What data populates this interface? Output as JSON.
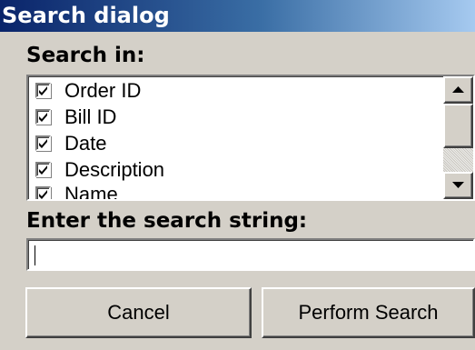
{
  "window": {
    "title": "Search dialog"
  },
  "search_in": {
    "label": "Search in:",
    "fields": [
      {
        "label": "Order ID",
        "checked": true
      },
      {
        "label": "Bill ID",
        "checked": true
      },
      {
        "label": "Date",
        "checked": true
      },
      {
        "label": "Description",
        "checked": true
      },
      {
        "label": "Name",
        "checked": true
      }
    ]
  },
  "search_string": {
    "label": "Enter the search string:",
    "value": ""
  },
  "buttons": {
    "cancel": "Cancel",
    "perform": "Perform Search"
  },
  "icons": {
    "check": "checkmark-icon",
    "up": "scroll-up-arrow-icon",
    "down": "scroll-down-arrow-icon"
  },
  "colors": {
    "title_start": "#0a246a",
    "title_end": "#a6caf0",
    "face": "#d4d0c8"
  }
}
